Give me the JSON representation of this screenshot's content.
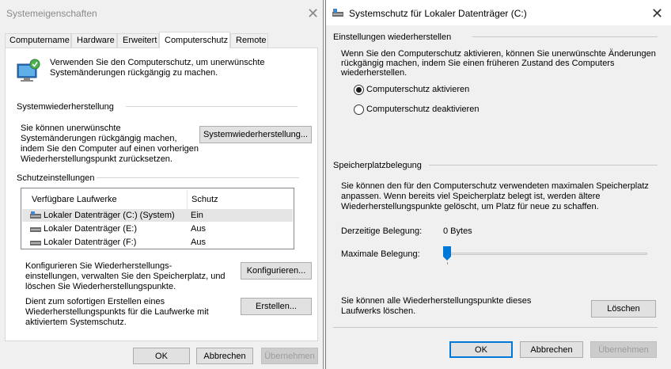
{
  "left_dialog": {
    "title": "Systemeigenschaften",
    "tabs": [
      "Computername",
      "Hardware",
      "Erweitert",
      "Computerschutz",
      "Remote"
    ],
    "active_tab": "Computerschutz",
    "intro": [
      "Verwenden Sie den Computerschutz, um unerwünschte",
      "Systemänderungen rückgängig zu machen."
    ],
    "restore_heading": "Systemwiederherstellung",
    "restore_text": [
      "Sie können unerwünschte",
      "Systemänderungen rückgängig machen,",
      "indem Sie den Computer auf einen vorherigen",
      "Wiederherstellungspunkt zurücksetzen."
    ],
    "restore_button": "Systemwiederherstellung...",
    "protection_heading": "Schutzeinstellungen",
    "table": {
      "headers": [
        "Verfügbare Laufwerke",
        "Schutz"
      ],
      "rows": [
        {
          "drive": "Lokaler Datenträger (C:) (System)",
          "status": "Ein"
        },
        {
          "drive": "Lokaler Datenträger (E:)",
          "status": "Aus"
        },
        {
          "drive": "Lokaler Datenträger (F:)",
          "status": "Aus"
        }
      ]
    },
    "configure_text": [
      "Konfigurieren Sie Wiederherstellungs-",
      "einstellungen, verwalten Sie den Speicherplatz, und",
      "löschen Sie Wiederherstellungspunkte."
    ],
    "configure_button": "Konfigurieren...",
    "create_text": [
      "Dient zum sofortigen Erstellen eines",
      "Wiederherstellungspunkts für die Laufwerke mit",
      "aktiviertem Systemschutz."
    ],
    "create_button": "Erstellen...",
    "ok": "OK",
    "cancel": "Abbrechen",
    "apply": "Übernehmen"
  },
  "right_dialog": {
    "title": "Systemschutz für Lokaler Datenträger (C:)",
    "restore_settings_heading": "Einstellungen wiederherstellen",
    "restore_settings_text": [
      "Wenn Sie den Computerschutz aktivieren, können Sie unerwünschte Änderungen",
      "rückgängig machen, indem Sie einen früheren Zustand des Computers",
      "wiederherstellen."
    ],
    "radio_on": "Computerschutz aktivieren",
    "radio_off": "Computerschutz deaktivieren",
    "selected_option": "Computerschutz aktivieren",
    "disk_heading": "Speicherplatzbelegung",
    "disk_text": [
      "Sie können den für den Computerschutz verwendeten maximalen Speicherplatz",
      "anpassen. Wenn bereits viel Speicherplatz belegt ist, werden ältere",
      "Wiederherstellungspunkte gelöscht, um Platz für neue zu schaffen."
    ],
    "current_usage_label": "Derzeitige Belegung:",
    "current_usage_value": "0 Bytes",
    "max_usage_label": "Maximale Belegung:",
    "max_usage_fraction": 0,
    "delete_text": [
      "Sie können alle Wiederherstellungspunkte dieses",
      "Laufwerks löschen."
    ],
    "delete_button": "Löschen",
    "ok": "OK",
    "cancel": "Abbrechen",
    "apply": "Übernehmen"
  },
  "colors": {
    "accent": "#0078d7",
    "window_bg": "#f0f0f0",
    "tab_panel": "#ffffff"
  }
}
